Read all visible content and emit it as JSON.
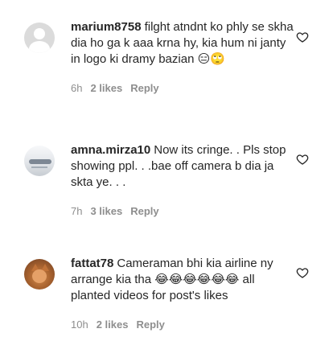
{
  "comments": [
    {
      "username": "marium8758",
      "text": "filght atndnt ko phly se skha dia ho ga k aaa krna hy, kia hum ni janty in logo ki dramy bazian 😑🙄",
      "age": "6h",
      "likes": "2 likes",
      "reply": "Reply"
    },
    {
      "username": "amna.mirza10",
      "text": "Now its cringe. . Pls stop showing ppl. . .bae off camera b dia ja skta ye. . .",
      "age": "7h",
      "likes": "3 likes",
      "reply": "Reply"
    },
    {
      "username": "fattat78",
      "text": "Cameraman bhi kia airline ny arrange kia tha 😂😂😂😂😂😂 all planted videos for post's likes",
      "age": "10h",
      "likes": "2 likes",
      "reply": "Reply"
    }
  ],
  "icons": {
    "like": "heart-outline-icon"
  }
}
